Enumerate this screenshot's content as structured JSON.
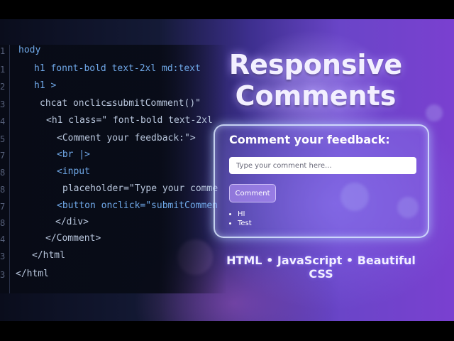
{
  "code": {
    "line_numbers": [
      "1",
      "1",
      "2",
      "3",
      "4",
      "5",
      "7",
      "8",
      "8",
      "7",
      "8",
      "4",
      "3",
      "3"
    ],
    "lines": [
      "hody",
      "h1 fonnt-bold  text-2xl md:text",
      "h1 >",
      "chcat onclic≤submitComment()\"",
      "<h1 class=\" font-bold text-2xl",
      "<Comment your feedback:\">",
      "<br |>",
      "<input",
      "placeholder=\"Type your comme",
      "<button onclick=\"submitCommen",
      "</div>",
      "</Comment>",
      "</html",
      "</html"
    ]
  },
  "title": {
    "line1": "Responsive",
    "line2": "Comments"
  },
  "card": {
    "heading": "Comment your feedback:",
    "input_placeholder": "Type your comment here...",
    "button_label": "Comment",
    "comments": [
      "HI",
      "Test"
    ]
  },
  "subtitle": "HTML • JavaScript • Beautiful CSS"
}
